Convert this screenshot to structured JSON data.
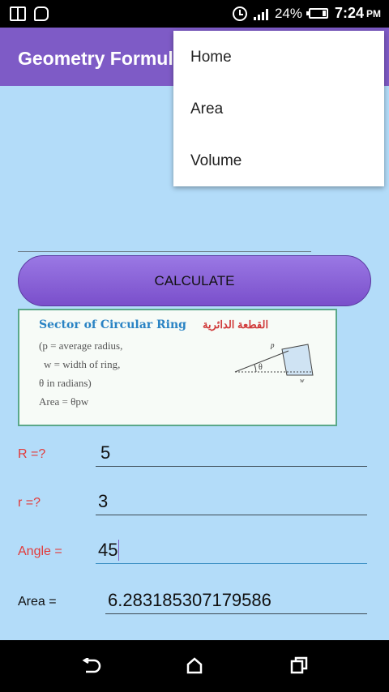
{
  "status_bar": {
    "battery": "24%",
    "battery_level": 0.24,
    "time": "7:24",
    "ampm": "PM"
  },
  "app_bar": {
    "title": "Geometry Formulas"
  },
  "overflow_menu": {
    "items": [
      "Home",
      "Area",
      "Volume"
    ]
  },
  "calculate_button": {
    "label": "CALCULATE"
  },
  "formula_card": {
    "title": "Sector of Circular Ring",
    "title_arabic": "القطعة الدائرية",
    "lines": [
      "(p = average radius,",
      "w = width of ring,",
      "θ in radians)",
      "Area = θpw"
    ],
    "diagram_labels": {
      "p": "p",
      "theta": "θ",
      "w": "w"
    }
  },
  "fields": [
    {
      "label": "R =?",
      "value": "5",
      "label_color": "#e23b3b"
    },
    {
      "label": "r =?",
      "value": "3",
      "label_color": "#e23b3b"
    },
    {
      "label": "Angle =",
      "value": "45",
      "label_color": "#e23b3b"
    },
    {
      "label": "Area =",
      "value": "6.283185307179586",
      "label_color": "#111111"
    }
  ],
  "colors": {
    "app_bar": "#7e5bc6",
    "background": "#b3dcf9",
    "button": "#8a62d8",
    "label_red": "#e23b3b"
  },
  "nav_bar": {
    "icons": [
      "back-icon",
      "home-icon",
      "recent-apps-icon"
    ]
  }
}
